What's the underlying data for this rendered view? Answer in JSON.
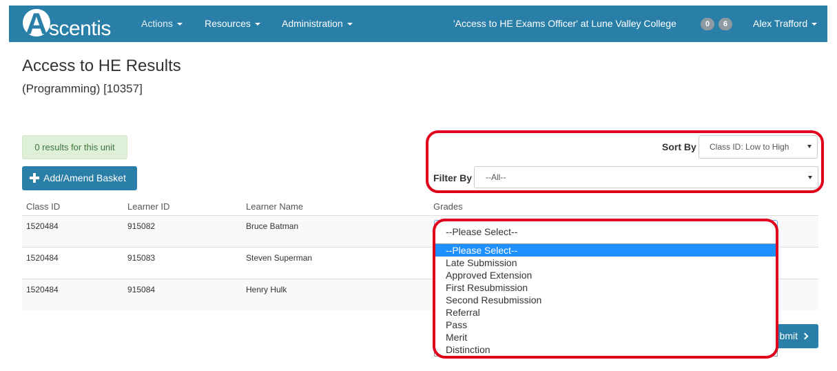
{
  "navbar": {
    "logo_initial": "A",
    "logo_rest": "scentis",
    "menu": [
      {
        "label": "Actions"
      },
      {
        "label": "Resources"
      },
      {
        "label": "Administration"
      }
    ],
    "role": "'Access to HE Exams Officer' at Lune Valley College",
    "badges": [
      "0",
      "6"
    ],
    "user": "Alex Trafford",
    "bar_color": "#2a7fa8"
  },
  "page": {
    "title": "Access to HE Results",
    "subtitle": "(Programming) [10357]"
  },
  "results": {
    "count_text": "0 results for this unit"
  },
  "add_button": {
    "label": "Add/Amend Basket",
    "icon": "plus-icon"
  },
  "sort": {
    "label": "Sort By",
    "selected": "Class ID: Low to High"
  },
  "filter": {
    "label": "Filter By",
    "selected": "--All--"
  },
  "table": {
    "columns": [
      "Class ID",
      "Learner ID",
      "Learner Name",
      "Grades"
    ],
    "rows": [
      {
        "class_id": "1520484",
        "learner_id": "915082",
        "name": "Bruce Batman"
      },
      {
        "class_id": "1520484",
        "learner_id": "915083",
        "name": "Steven Superman"
      },
      {
        "class_id": "1520484",
        "learner_id": "915084",
        "name": "Henry Hulk"
      }
    ]
  },
  "grade_select": {
    "selected": "--Please Select--",
    "options": [
      "--Please Select--",
      "Late Submission",
      "Approved Extension",
      "First Resubmission",
      "Second Resubmission",
      "Referral",
      "Pass",
      "Merit",
      "Distinction"
    ],
    "highlighted_index": 0
  },
  "submit": {
    "visible_label": "bmit",
    "icon": "chevron-right-icon"
  },
  "colors": {
    "primary": "#2a7fa8",
    "annotation_red": "#e0001b",
    "success_bg": "#dff0d8",
    "success_text": "#3c763d",
    "option_highlight": "#1e90ff"
  }
}
